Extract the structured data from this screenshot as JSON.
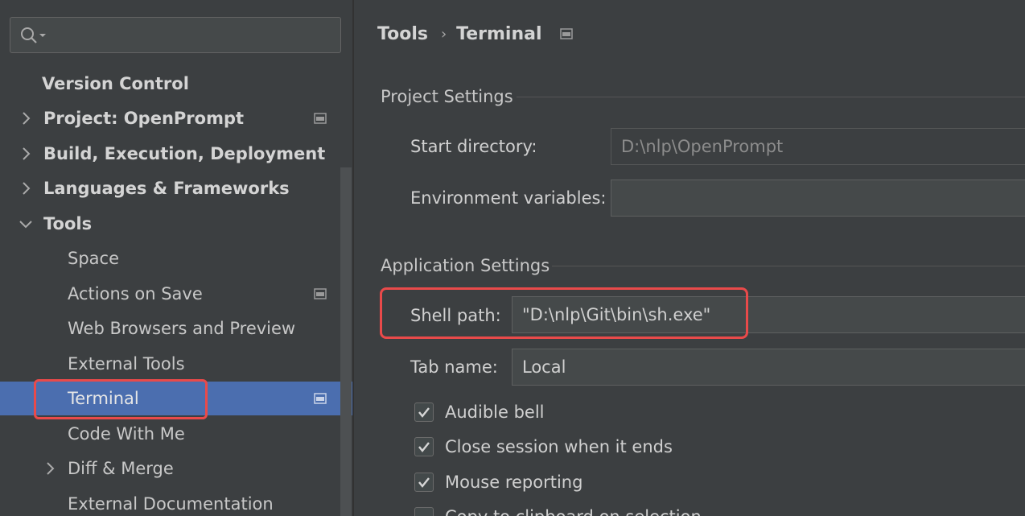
{
  "search": {
    "placeholder": "",
    "value": ""
  },
  "sidebar": {
    "items": [
      {
        "label": "Version Control"
      },
      {
        "label": "Project: OpenPrompt"
      },
      {
        "label": "Build, Execution, Deployment"
      },
      {
        "label": "Languages & Frameworks"
      },
      {
        "label": "Tools"
      },
      {
        "label": "Space"
      },
      {
        "label": "Actions on Save"
      },
      {
        "label": "Web Browsers and Preview"
      },
      {
        "label": "External Tools"
      },
      {
        "label": "Terminal"
      },
      {
        "label": "Code With Me"
      },
      {
        "label": "Diff & Merge"
      },
      {
        "label": "External Documentation"
      }
    ]
  },
  "breadcrumb": {
    "parent": "Tools",
    "separator": "›",
    "current": "Terminal"
  },
  "project_settings": {
    "title": "Project Settings",
    "start_directory_label": "Start directory:",
    "start_directory_value": "D:\\nlp\\OpenPrompt",
    "env_vars_label": "Environment variables:",
    "env_vars_value": ""
  },
  "application_settings": {
    "title": "Application Settings",
    "shell_path_label": "Shell path:",
    "shell_path_value": "\"D:\\nlp\\Git\\bin\\sh.exe\"",
    "tab_name_label": "Tab name:",
    "tab_name_value": "Local",
    "options": [
      {
        "label": "Audible bell",
        "checked": true
      },
      {
        "label": "Close session when it ends",
        "checked": true
      },
      {
        "label": "Mouse reporting",
        "checked": true
      },
      {
        "label": "Copy to clipboard on selection",
        "checked": false
      }
    ]
  },
  "colors": {
    "background": "#3c3f41",
    "selection": "#4b6eaf",
    "highlight": "#e94a4a"
  }
}
